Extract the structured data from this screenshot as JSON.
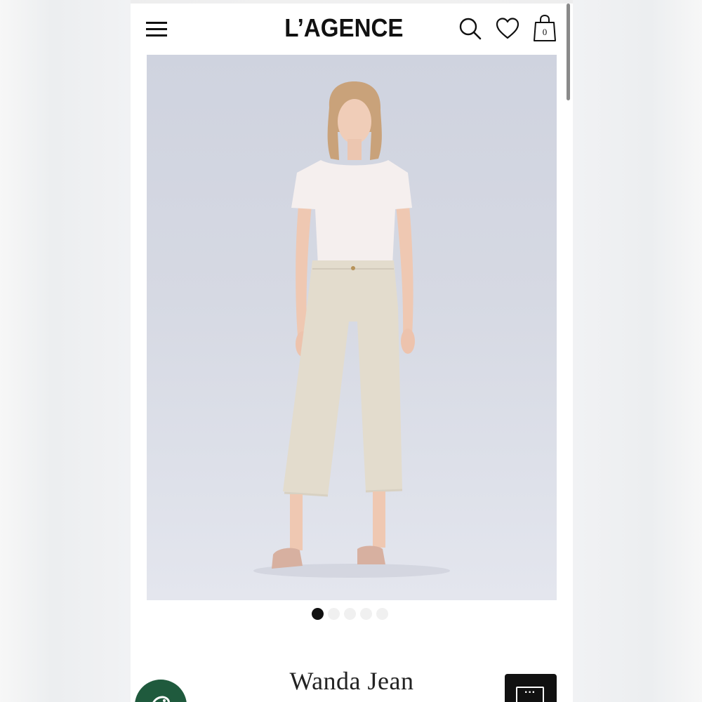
{
  "header": {
    "brand": "L’AGENCE",
    "cart_count": "0",
    "icons": [
      "menu-icon",
      "search-icon",
      "heart-icon",
      "shopping-bag-icon"
    ]
  },
  "gallery": {
    "image": "product-photo",
    "slide_count": 5,
    "active_slide": 1
  },
  "product": {
    "name": "Wanda Jean"
  },
  "floating": {
    "chat_icon": "chat-badge-icon",
    "more_label": "···"
  },
  "colors": {
    "brand_text": "#111111",
    "hero_bg": "#d6d9e3",
    "chat_badge": "#1f5a3d",
    "dot_active": "#111111",
    "dot_inactive": "#f0f0f0"
  }
}
